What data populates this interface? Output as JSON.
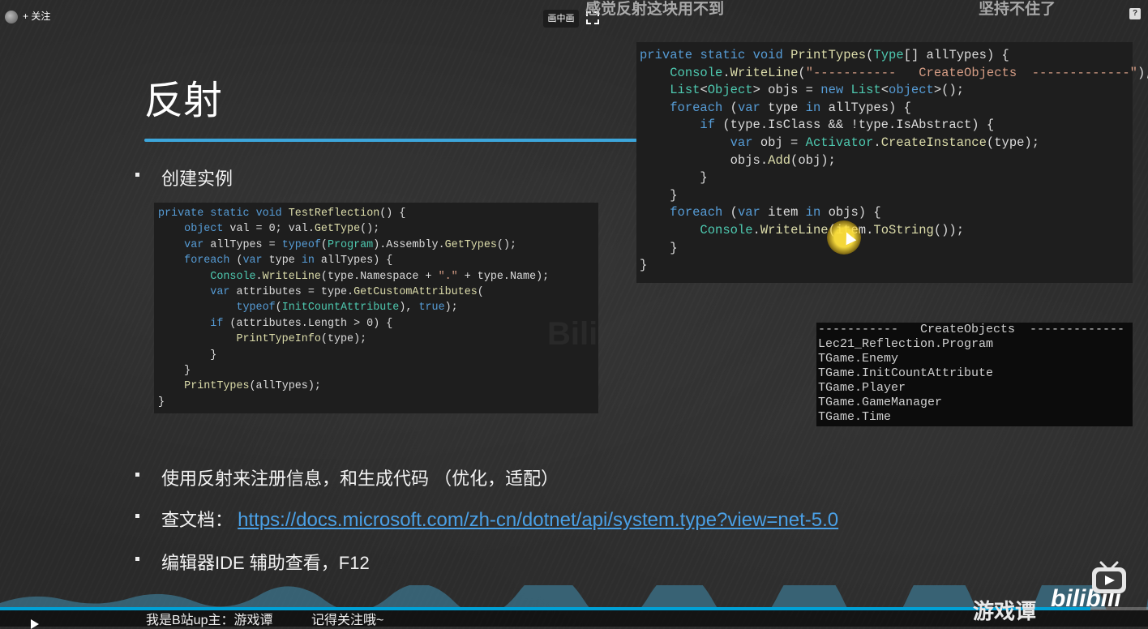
{
  "overlay": {
    "follow_label": "+ 关注",
    "pip_label": "画中画",
    "danmaku": [
      "感觉反射这块用不到",
      "坚持不住了"
    ],
    "help_label": "?"
  },
  "slide": {
    "title": "反射",
    "bullets": [
      "创建实例",
      "使用反射来注册信息，和生成代码 （优化，适配）",
      "查文档：",
      "编辑器IDE 辅助查看，F12"
    ],
    "doc_url": "https://docs.microsoft.com/zh-cn/dotnet/api/system.type?view=net-5.0"
  },
  "code_left": [
    "private static void TestReflection() {",
    "    object val = 0; val.GetType();",
    "    var allTypes = typeof(Program).Assembly.GetTypes();",
    "    foreach (var type in allTypes) {",
    "        Console.WriteLine(type.Namespace + \".\" + type.Name);",
    "        var attributes = type.GetCustomAttributes(",
    "            typeof(InitCountAttribute), true);",
    "        if (attributes.Length > 0) {",
    "            PrintTypeInfo(type);",
    "        }",
    "    }",
    "    PrintTypes(allTypes);",
    "}"
  ],
  "code_right": [
    "private static void PrintTypes(Type[] allTypes) {",
    "    Console.WriteLine(\"-----------   CreateObjects  -------------\");",
    "    List<Object> objs = new List<object>();",
    "    foreach (var type in allTypes) {",
    "        if (type.IsClass && !type.IsAbstract) {",
    "            var obj = Activator.CreateInstance(type);",
    "            objs.Add(obj);",
    "        }",
    "    }",
    "    foreach (var item in objs) {",
    "        Console.WriteLine(item.ToString());",
    "    }",
    "}"
  ],
  "console_output": [
    "-----------   CreateObjects  -------------",
    "Lec21_Reflection.Program",
    "TGame.Enemy",
    "TGame.InitCountAttribute",
    "TGame.Player",
    "TGame.GameManager",
    "TGame.Time"
  ],
  "bottom": {
    "subtitle_left": "我是B站up主：游戏谭",
    "subtitle_right": "记得关注哦~",
    "channel_name": "游戏谭",
    "brand": "bilibili",
    "progress": 0.95,
    "accent": "#00a1d6"
  },
  "colors": {
    "title_line": "#3da6db",
    "link": "#4aa0e6",
    "code_bg": "#1e1e1e",
    "console_bg": "#0c0c0c"
  }
}
